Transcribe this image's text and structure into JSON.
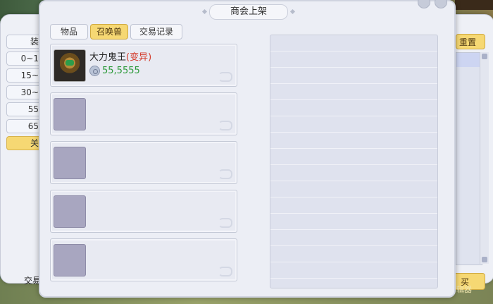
{
  "window": {
    "title": "商会上架"
  },
  "tabs": [
    {
      "label": "物品",
      "active": false
    },
    {
      "label": "召唤兽",
      "active": true
    },
    {
      "label": "交易记录",
      "active": false
    }
  ],
  "slots": [
    {
      "name": "大力鬼王",
      "tag": "(变异)",
      "price": "55,5555"
    },
    {},
    {},
    {},
    {}
  ],
  "background_panel": {
    "left_items": [
      "装",
      "0~1",
      "15~",
      "30~",
      "55",
      "65",
      "关"
    ],
    "reset_label": "重置",
    "buy_label": "买",
    "trade_label": "交易",
    "corner_label": "辑器"
  },
  "colors": {
    "accent": "#f6d873",
    "price": "#2c9a3a",
    "mutation": "#d33a2a"
  }
}
